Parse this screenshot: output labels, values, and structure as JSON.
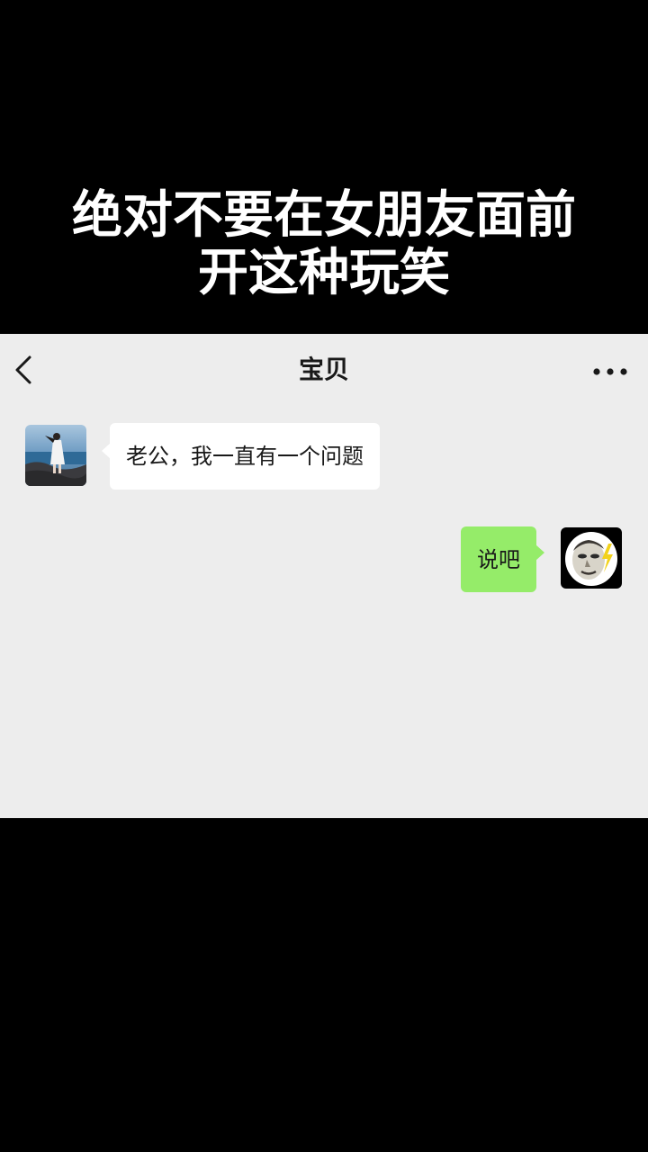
{
  "caption": {
    "line1": "绝对不要在女朋友面前",
    "line2": "开这种玩笑"
  },
  "chat": {
    "title": "宝贝",
    "back_icon": "chevron-left-icon",
    "more_icon": "more-dots-icon",
    "messages": [
      {
        "side": "left",
        "text": "老公，我一直有一个问题"
      },
      {
        "side": "right",
        "text": "说吧"
      }
    ]
  },
  "colors": {
    "background": "#000000",
    "chat_background": "#ededed",
    "incoming_bubble": "#ffffff",
    "outgoing_bubble": "#95ec69",
    "caption_text": "#ffffff"
  }
}
